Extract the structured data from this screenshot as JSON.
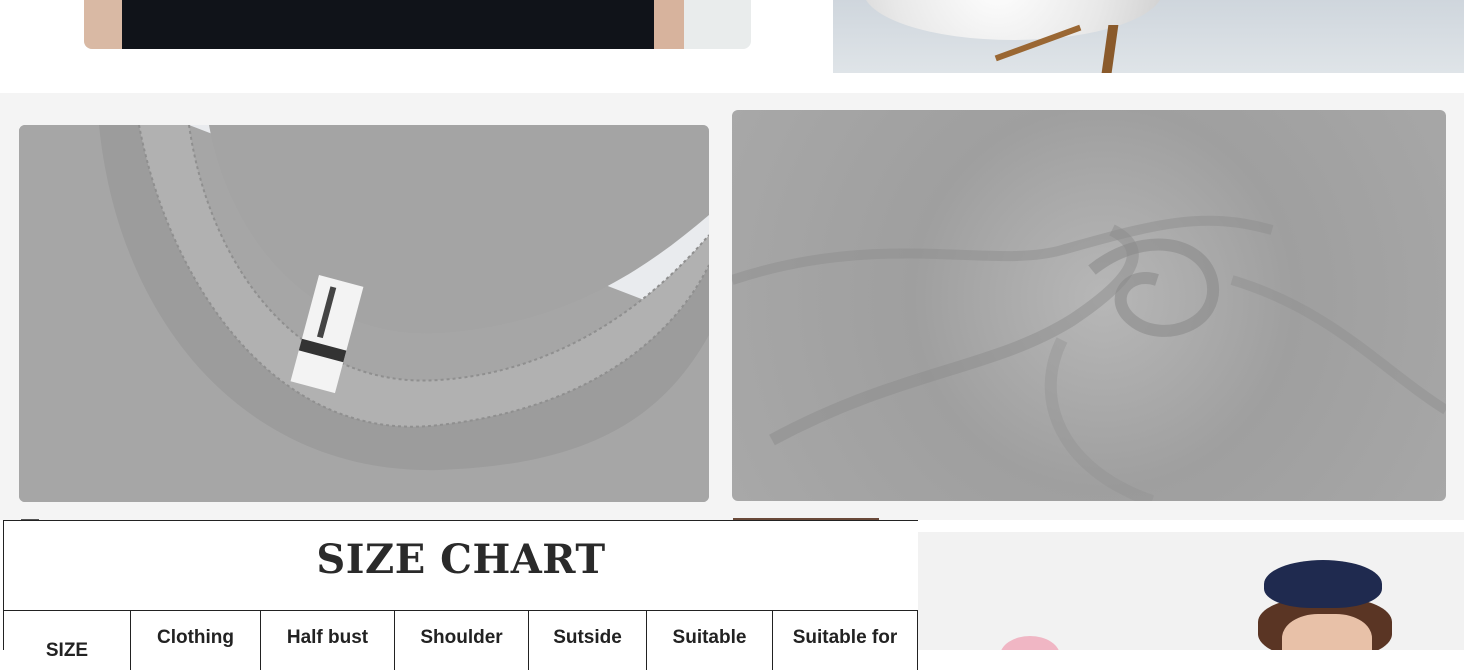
{
  "size_chart": {
    "title": "SIZE CHART",
    "headers": [
      "SIZE",
      "Clothing",
      "Half bust",
      "Shoulder",
      "Sutside",
      "Suitable",
      "Suitable for"
    ]
  },
  "colors": {
    "section_bg": "#f4f4f4",
    "fabric_gray": "#a9a9a9",
    "text_dark": "#2a2a2a"
  }
}
